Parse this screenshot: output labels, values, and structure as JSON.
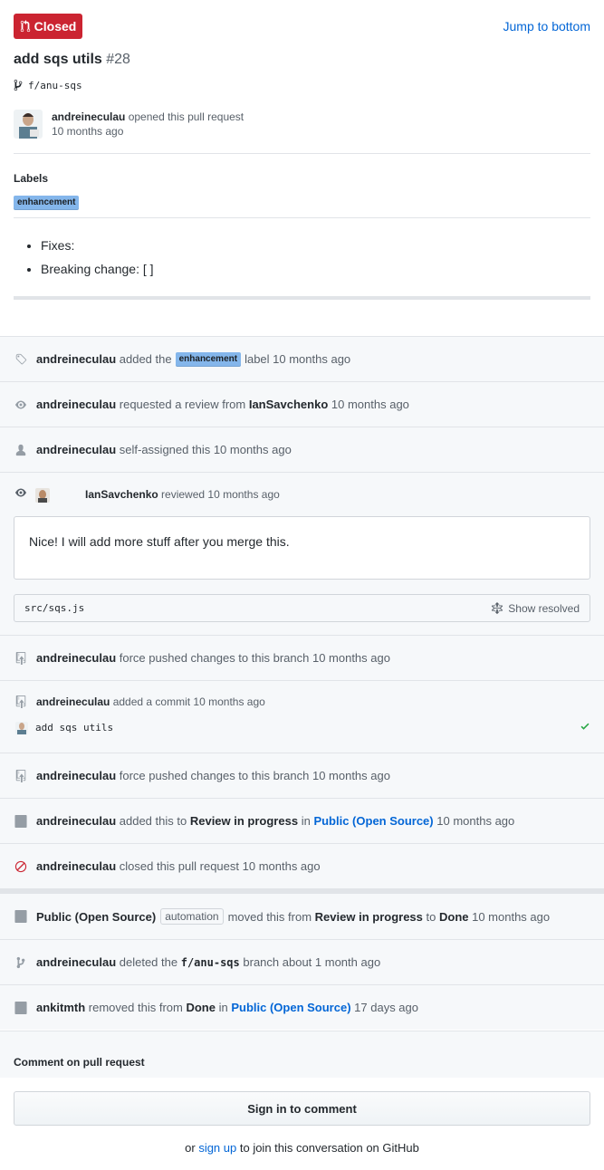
{
  "header": {
    "state_label": "Closed",
    "jump_label": "Jump to bottom",
    "title": "add sqs utils",
    "number": "#28",
    "branch": "f/anu-sqs",
    "opener_user": "andreineculau",
    "opener_action": "opened this pull request",
    "opener_time": "10 months ago"
  },
  "labels": {
    "heading": "Labels",
    "items": [
      "enhancement"
    ],
    "color": "#84b6eb"
  },
  "body": {
    "items": [
      "Fixes:",
      "Breaking change: [ ]"
    ]
  },
  "timeline": {
    "label_event": {
      "user": "andreineculau",
      "pre": "added the",
      "label": "enhancement",
      "post": "label 10 months ago"
    },
    "review_request": {
      "user": "andreineculau",
      "pre": "requested a review from",
      "target": "IanSavchenko",
      "post": "10 months ago"
    },
    "self_assign": {
      "user": "andreineculau",
      "text": "self-assigned this 10 months ago"
    },
    "review": {
      "user": "IanSavchenko",
      "text": "reviewed 10 months ago",
      "comment": "Nice! I will add more stuff after you merge this.",
      "file": "src/sqs.js",
      "show_resolved": "Show resolved"
    },
    "force_push_1": {
      "user": "andreineculau",
      "text": "force pushed changes to this branch 10 months ago"
    },
    "commit": {
      "user": "andreineculau",
      "text": "added a commit 10 months ago",
      "message": "add sqs utils"
    },
    "force_push_2": {
      "user": "andreineculau",
      "text": "force pushed changes to this branch 10 months ago"
    },
    "project_add": {
      "user": "andreineculau",
      "pre": "added this to",
      "column": "Review in progress",
      "mid": "in",
      "project": "Public (Open Source)",
      "post": "10 months ago"
    },
    "closed": {
      "user": "andreineculau",
      "text": "closed this pull request 10 months ago"
    },
    "moved": {
      "project": "Public (Open Source)",
      "badge": "automation",
      "pre": "moved this from",
      "from": "Review in progress",
      "mid": "to",
      "to": "Done",
      "post": "10 months ago"
    },
    "deleted": {
      "user": "andreineculau",
      "pre": "deleted the",
      "branch": "f/anu-sqs",
      "post": "branch about 1 month ago"
    },
    "removed": {
      "user": "ankitmth",
      "pre": "removed this from",
      "column": "Done",
      "mid": "in",
      "project": "Public (Open Source)",
      "post": "17 days ago"
    }
  },
  "footer": {
    "heading": "Comment on pull request",
    "signin_label": "Sign in to comment",
    "pre": "or",
    "signup_link": "sign up",
    "post": "to join this conversation on GitHub"
  },
  "colors": {
    "closed_red": "#cb2431",
    "link_blue": "#0366d6",
    "success_green": "#28a745"
  }
}
